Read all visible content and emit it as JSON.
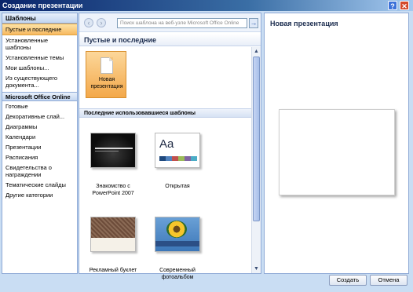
{
  "window": {
    "title": "Создание презентации",
    "help_glyph": "?",
    "close_glyph": "✕"
  },
  "left_panel": {
    "header": "Шаблоны",
    "items": [
      {
        "label": "Пустые и последние",
        "active": true
      },
      {
        "label": "Установленные шаблоны",
        "active": false
      },
      {
        "label": "Установленные темы",
        "active": false
      },
      {
        "label": "Мои шаблоны...",
        "active": false
      },
      {
        "label": "Из существующего документа...",
        "active": false
      }
    ],
    "online_header": "Microsoft Office Online",
    "online_items": [
      "Готовые",
      "Декоративные слай...",
      "Диаграммы",
      "Календари",
      "Презентации",
      "Расписания",
      "Свидетельства о награждении",
      "Тематические слайды",
      "Другие категории"
    ]
  },
  "middle_panel": {
    "search_placeholder": "Поиск шаблона на веб-узле Microsoft Office Online",
    "title": "Пустые и последние",
    "new_presentation": "Новая презентация",
    "recent_header": "Последние использовавшиеся шаблоны",
    "templates": [
      {
        "label": "Знакомство с PowerPoint 2007"
      },
      {
        "label": "Открытая"
      },
      {
        "label": "Рекламный буклет"
      },
      {
        "label": "Современный фотоальбом"
      }
    ],
    "aa_text": "Aa"
  },
  "right_panel": {
    "title": "Новая презентация"
  },
  "buttons": {
    "create": "Создать",
    "cancel": "Отмена"
  },
  "colors": {
    "accent_selected": "#f7b960",
    "frame": "#c9ddf3",
    "title_bar": "#0a246a",
    "open_theme_swatches": [
      "#1f497d",
      "#4f81bd",
      "#c0504d",
      "#9bbb59",
      "#8064a2",
      "#4bacc6"
    ]
  }
}
